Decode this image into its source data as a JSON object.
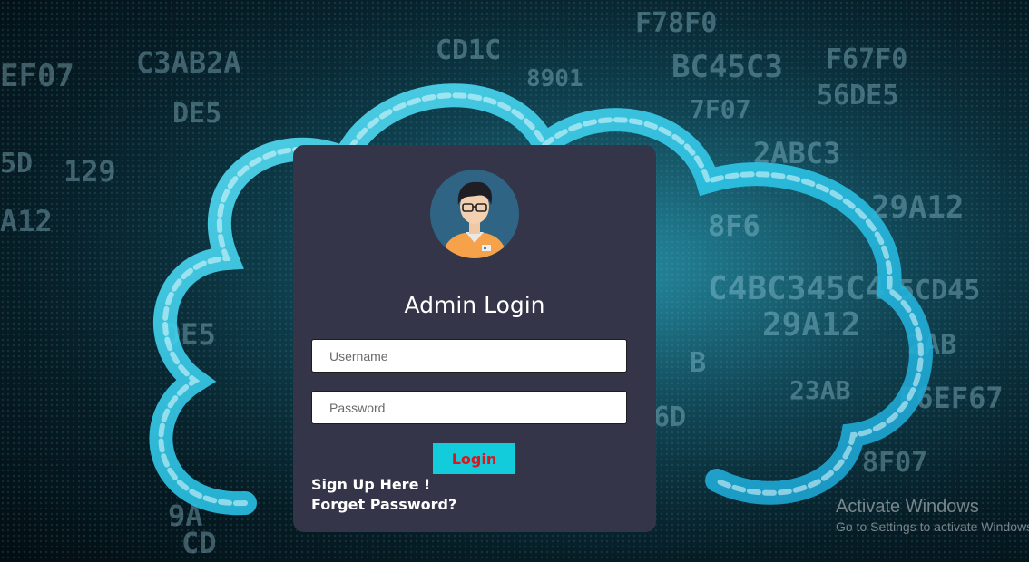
{
  "page": {
    "background_art": "cloud-data-hex-background"
  },
  "login_card": {
    "avatar_icon": "admin-avatar-icon",
    "title": "Admin Login",
    "username_placeholder": "Username",
    "password_placeholder": "Password",
    "login_label": "Login",
    "signup_label": "Sign Up Here !",
    "forget_label": "Forget Password?"
  },
  "colors": {
    "card_bg": "#343548",
    "login_button_bg": "#12ccdb",
    "login_button_text": "#e0141e"
  },
  "watermark": {
    "title": "Activate Windows",
    "subtitle": "Go to Settings to activate Windows."
  }
}
